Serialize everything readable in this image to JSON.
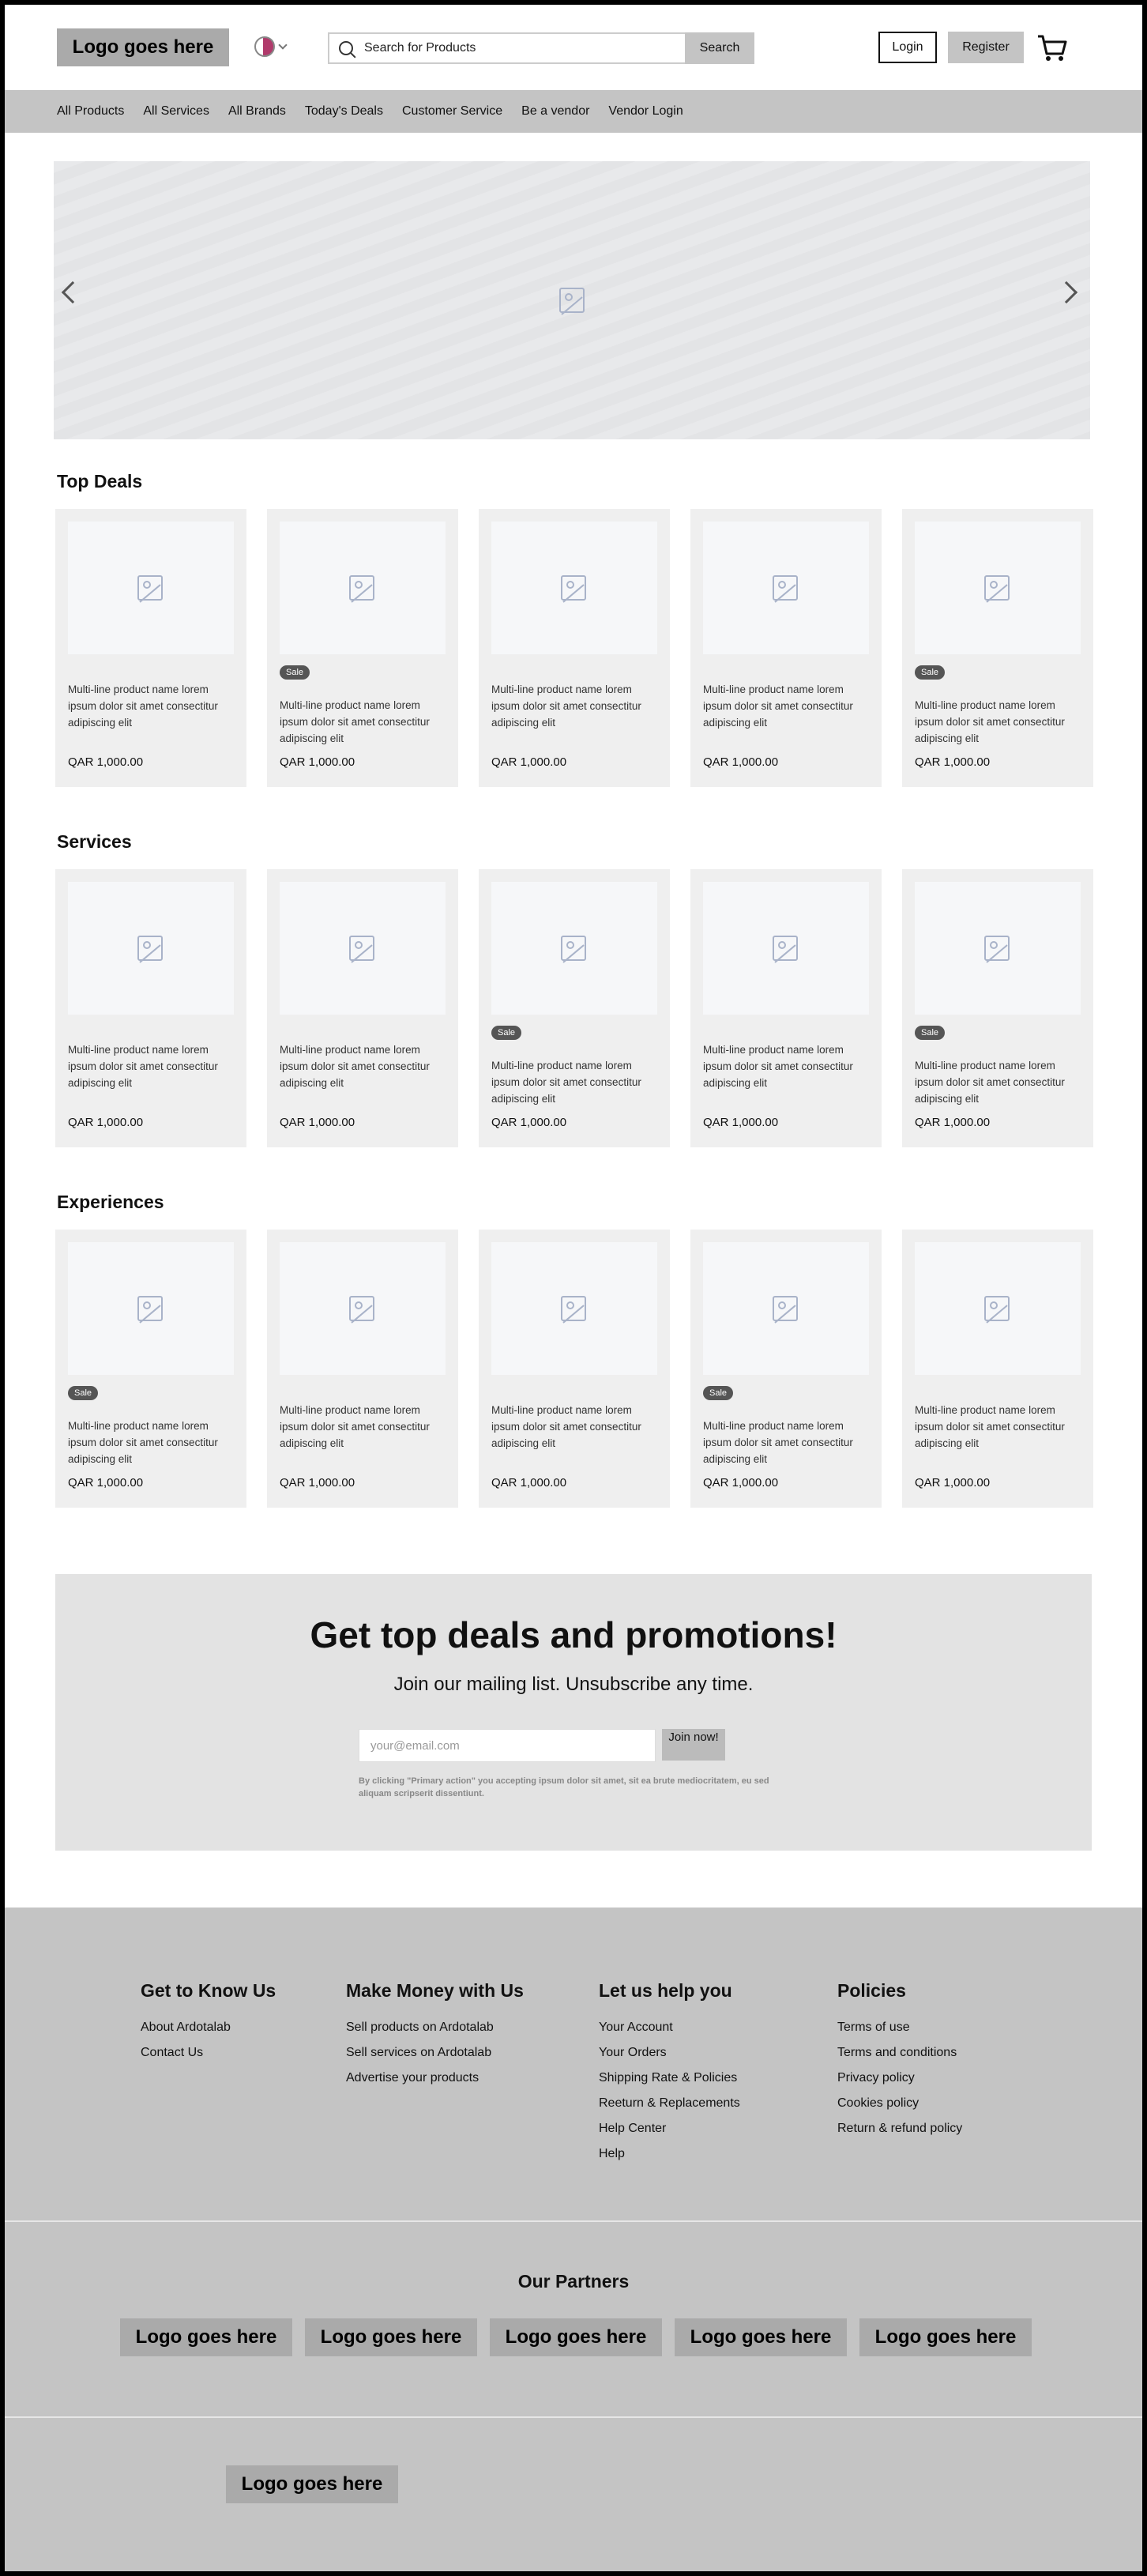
{
  "header": {
    "logo": "Logo goes here",
    "search_placeholder": "Search for Products",
    "search_button": "Search",
    "login": "Login",
    "register": "Register"
  },
  "nav": [
    "All Products",
    "All Services",
    "All Brands",
    "Today's Deals",
    "Customer Service",
    "Be a vendor",
    "Vendor Login"
  ],
  "sections": {
    "top_deals": {
      "title": "Top Deals",
      "cards": [
        {
          "name": "Multi-line product name lorem ipsum dolor sit amet consectitur adipiscing elit",
          "price": "QAR 1,000.00",
          "sale": ""
        },
        {
          "name": "Multi-line product name lorem ipsum dolor sit amet consectitur adipiscing elit",
          "price": "QAR 1,000.00",
          "sale": "Sale"
        },
        {
          "name": "Multi-line product name lorem ipsum dolor sit amet consectitur adipiscing elit",
          "price": "QAR 1,000.00",
          "sale": ""
        },
        {
          "name": "Multi-line product name lorem ipsum dolor sit amet consectitur adipiscing elit",
          "price": "QAR 1,000.00",
          "sale": ""
        },
        {
          "name": "Multi-line product name lorem ipsum dolor sit amet consectitur adipiscing elit",
          "price": "QAR 1,000.00",
          "sale": "Sale"
        }
      ]
    },
    "services": {
      "title": "Services",
      "cards": [
        {
          "name": "Multi-line product name lorem ipsum dolor sit amet consectitur adipiscing elit",
          "price": "QAR 1,000.00",
          "sale": ""
        },
        {
          "name": "Multi-line product name lorem ipsum dolor sit amet consectitur adipiscing elit",
          "price": "QAR 1,000.00",
          "sale": ""
        },
        {
          "name": "Multi-line product name lorem ipsum dolor sit amet consectitur adipiscing elit",
          "price": "QAR 1,000.00",
          "sale": "Sale"
        },
        {
          "name": "Multi-line product name lorem ipsum dolor sit amet consectitur adipiscing elit",
          "price": "QAR 1,000.00",
          "sale": ""
        },
        {
          "name": "Multi-line product name lorem ipsum dolor sit amet consectitur adipiscing elit",
          "price": "QAR 1,000.00",
          "sale": "Sale"
        }
      ]
    },
    "experiences": {
      "title": "Experiences",
      "cards": [
        {
          "name": "Multi-line product name lorem ipsum dolor sit amet consectitur adipiscing elit",
          "price": "QAR 1,000.00",
          "sale": "Sale"
        },
        {
          "name": "Multi-line product name lorem ipsum dolor sit amet consectitur adipiscing elit",
          "price": "QAR 1,000.00",
          "sale": ""
        },
        {
          "name": "Multi-line product name lorem ipsum dolor sit amet consectitur adipiscing elit",
          "price": "QAR 1,000.00",
          "sale": ""
        },
        {
          "name": "Multi-line product name lorem ipsum dolor sit amet consectitur adipiscing elit",
          "price": "QAR 1,000.00",
          "sale": "Sale"
        },
        {
          "name": "Multi-line product name lorem ipsum dolor sit amet consectitur adipiscing elit",
          "price": "QAR 1,000.00",
          "sale": ""
        }
      ]
    }
  },
  "promo": {
    "title": "Get top deals and promotions!",
    "subtitle": "Join our mailing list. Unsubscribe any time.",
    "email_placeholder": "your@email.com",
    "join": "Join now!",
    "legal": "By clicking \"Primary action\" you accepting ipsum dolor sit amet, sit ea brute mediocritatem, eu sed aliquam scripserit dissentiunt."
  },
  "footer": {
    "columns": [
      {
        "title": "Get to Know Us",
        "links": [
          "About Ardotalab",
          "Contact Us"
        ]
      },
      {
        "title": "Make Money with Us",
        "links": [
          "Sell products on Ardotalab",
          "Sell services on Ardotalab",
          "Advertise your products"
        ]
      },
      {
        "title": "Let us help you",
        "links": [
          "Your Account",
          "Your Orders",
          "Shipping Rate & Policies",
          "Reeturn & Replacements",
          "Help Center",
          "Help"
        ]
      },
      {
        "title": "Policies",
        "links": [
          "Terms of use",
          "Terms and conditions",
          "Privacy policy",
          "Cookies policy",
          "Return & refund policy"
        ]
      }
    ],
    "partners_title": "Our Partners",
    "partners": [
      "Logo goes here",
      "Logo goes here",
      "Logo goes here",
      "Logo goes here",
      "Logo goes here"
    ],
    "bottom_logo": "Logo goes here"
  },
  "colors": {
    "nav_bg": "#c4c4c4",
    "footer_bg": "#c4c4c4",
    "card_bg": "#efefef",
    "sale_badge": "#555555"
  }
}
